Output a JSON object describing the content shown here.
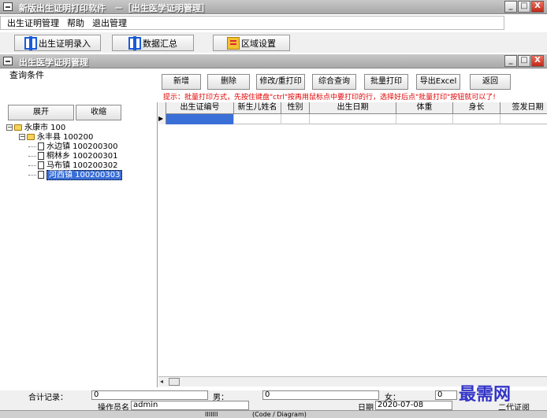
{
  "app": {
    "title": "新版出生证明打印软件　－［出生医学证明管理］"
  },
  "menu": {
    "items": [
      "出生证明管理",
      "帮助",
      "退出管理"
    ]
  },
  "toolbar": {
    "buttons": [
      "出生证明录入",
      "数据汇总",
      "区域设置"
    ]
  },
  "subwindow": {
    "title": "出生医学证明管理"
  },
  "query": {
    "label": "查询条件"
  },
  "actions": [
    "新增",
    "删除",
    "修改/重打印",
    "综合查询",
    "批量打印",
    "导出Excel",
    "返回"
  ],
  "hint": "提示：批量打印方式，先按住键盘\"ctrl\"按再用鼠标点中要打印的行，选择好后点\"批量打印\"按钮就可以了!",
  "tree_buttons": [
    "展开",
    "收缩"
  ],
  "tree": [
    {
      "label": "永康市  100",
      "level": 0
    },
    {
      "label": "永丰县  100200",
      "level": 1
    },
    {
      "label": "水边镇  100200300",
      "level": 2
    },
    {
      "label": "桐林乡  100200301",
      "level": 2
    },
    {
      "label": "马布镇  100200302",
      "level": 2
    },
    {
      "label": "河西镇  100200303",
      "level": 2,
      "selected": true
    }
  ],
  "grid": {
    "columns": [
      "出生证编号",
      "新生儿姓名",
      "性别",
      "出生日期",
      "体重",
      "身长",
      "签发日期"
    ]
  },
  "status": {
    "total_label": "合计记录：",
    "total_value": "0",
    "male_label": "男：",
    "male_value": "0",
    "female_label": "女：",
    "female_value": "0",
    "operator_label": "操作员名",
    "operator_value": "admin",
    "date_label": "日期",
    "date_value": "2020-07-08",
    "extra": "二代证阅"
  },
  "bottom": {
    "items": [
      "IIIIIII",
      "(Code / Diagram)"
    ]
  },
  "watermark": "最需网",
  "window_buttons": [
    "_",
    "□",
    "X"
  ]
}
